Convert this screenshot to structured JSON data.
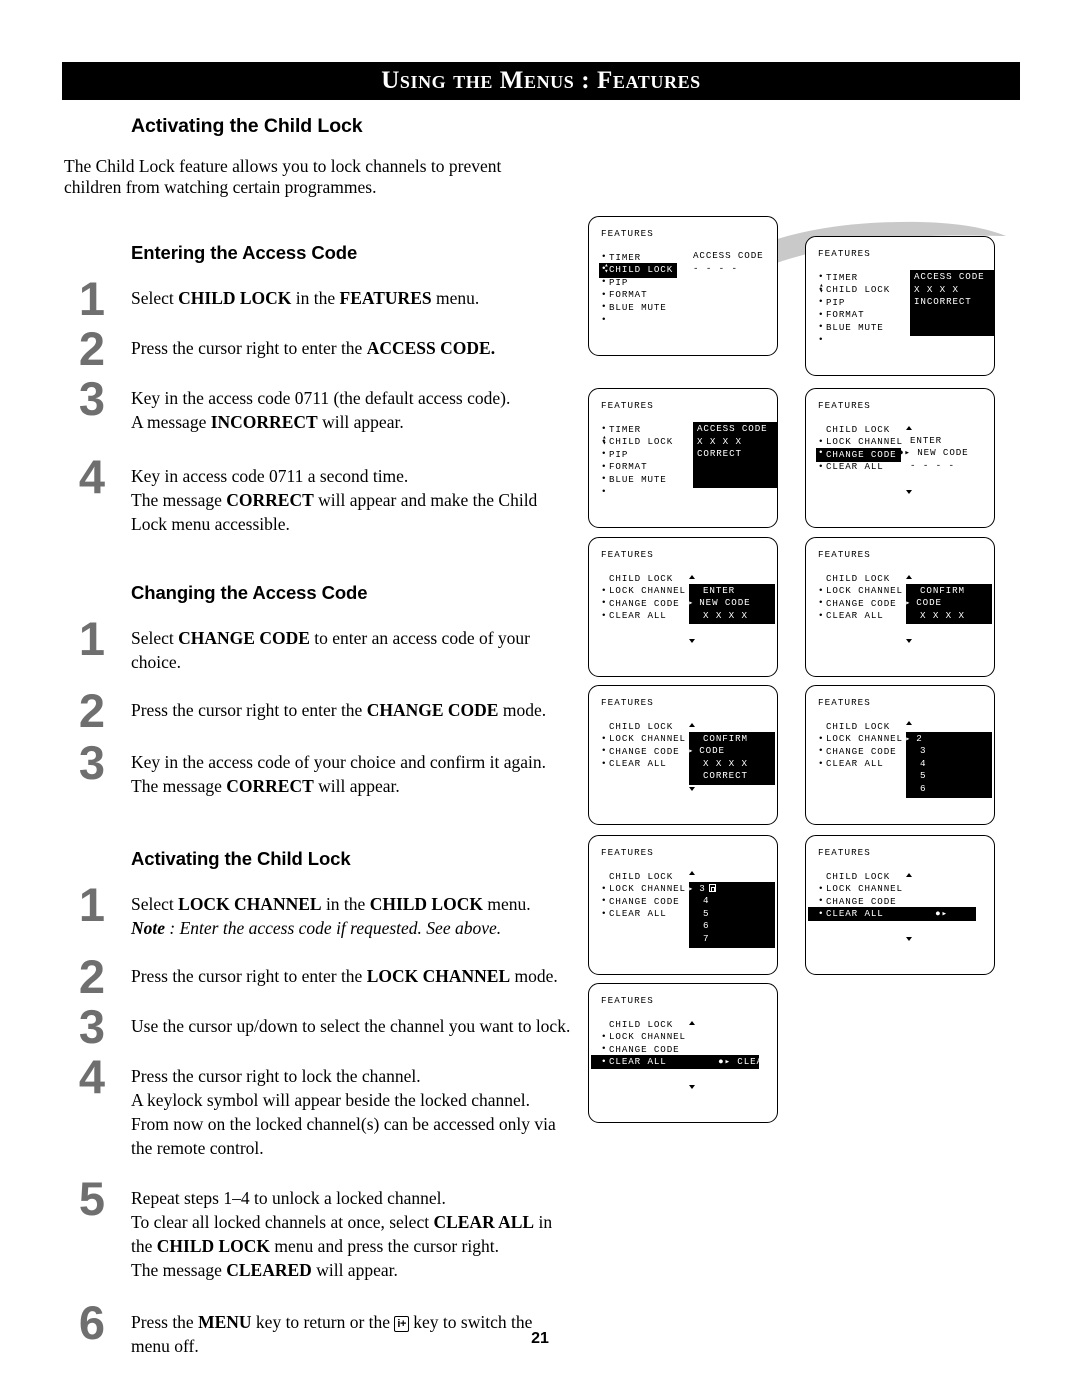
{
  "header": {
    "banner_title": "Using the Menus : Features"
  },
  "page_number": "21",
  "left": {
    "section_title": "Activating the Child Lock",
    "intro": "The Child Lock feature allows you to lock channels to prevent children from watching certain programmes.",
    "sub1_title": "Entering the Access Code",
    "sub2_title": "Changing the Access Code",
    "sub3_title": "Activating the Child Lock",
    "steps1": [
      {
        "num": "1",
        "lines": [
          "Select <b>CHILD LOCK</b> in the <b>FEATURES</b> menu."
        ]
      },
      {
        "num": "2",
        "lines": [
          "Press the cursor right to enter the <b>ACCESS CODE.</b>"
        ]
      },
      {
        "num": "3",
        "lines": [
          "Key in the access code 0711 (the default access code).",
          "A message <b>INCORRECT</b> will appear."
        ]
      },
      {
        "num": "4",
        "lines": [
          "Key in access code 0711 a second time.",
          "The message <b>CORRECT</b> will appear and make the Child Lock menu accessible."
        ]
      }
    ],
    "steps2": [
      {
        "num": "1",
        "lines": [
          "Select <b>CHANGE CODE</b> to enter an access code of your choice."
        ]
      },
      {
        "num": "2",
        "lines": [
          "Press the cursor right to enter the <b>CHANGE CODE</b> mode."
        ]
      },
      {
        "num": "3",
        "lines": [
          "Key in the access code of your choice and confirm it again.",
          "The message <b>CORRECT</b> will appear."
        ]
      }
    ],
    "steps3": [
      {
        "num": "1",
        "lines": [
          "Select <b>LOCK CHANNEL</b> in the <b>CHILD LOCK</b> menu.",
          "<i><b>Note</b> : Enter the access code if requested. See above.</i>"
        ]
      },
      {
        "num": "2",
        "lines": [
          "Press the cursor right to enter the <b>LOCK CHANNEL</b> mode."
        ]
      },
      {
        "num": "3",
        "lines": [
          "Use the cursor up/down to select the channel you want to lock."
        ]
      },
      {
        "num": "4",
        "lines": [
          "Press the cursor right to lock the channel.",
          "A keylock symbol will appear beside the locked channel.",
          "From now on the locked channel(s) can be accessed only via the remote control."
        ]
      },
      {
        "num": "5",
        "lines": [
          "Repeat steps 1–4 to unlock a locked channel.",
          "To clear all locked channels at once, select <b>CLEAR ALL</b> in the <b>CHILD LOCK</b> menu and press the cursor right.",
          "The message <b>CLEARED</b> will appear."
        ]
      },
      {
        "num": "6",
        "lines": [
          "Press the <b>MENU</b> key to return or the <span class=\"keyicon\">i+</span> key to switch the menu off.",
          ""
        ]
      }
    ]
  },
  "diagrams": [
    {
      "id": "d1",
      "head": "FEATURES",
      "rows": [
        "TIMER",
        "CHILD LOCK",
        "PIP",
        "FORMAT",
        "BLUE MUTE",
        ""
      ],
      "highlight_row": 1,
      "updown_row": 1,
      "values_plain": [
        "ACCESS CODE",
        "- - - -"
      ],
      "values_plain_row": 0
    },
    {
      "id": "d2",
      "head": "FEATURES",
      "rows": [
        "TIMER",
        "CHILD LOCK",
        "PIP",
        "FORMAT",
        "BLUE MUTE",
        ""
      ],
      "updown_row": 1,
      "panel": [
        "ACCESS CODE",
        "X X X X",
        "INCORRECT",
        "",
        ""
      ],
      "panel_row": 0
    },
    {
      "id": "d3",
      "head": "FEATURES",
      "rows": [
        "TIMER",
        "CHILD LOCK",
        "PIP",
        "FORMAT",
        "BLUE MUTE",
        ""
      ],
      "updown_row": 1,
      "panel": [
        "ACCESS CODE",
        "X X X X",
        "CORRECT",
        "",
        ""
      ],
      "panel_row": 0
    },
    {
      "id": "d4",
      "head": "FEATURES",
      "title_row": "CHILD LOCK",
      "rows": [
        "LOCK CHANNEL",
        "CHANGE CODE",
        "CLEAR ALL"
      ],
      "highlight_row": 1,
      "values_plain": [
        "ENTER",
        "NEW CODE",
        "- - - -"
      ],
      "cursor_marks": {
        "1": "●▸"
      },
      "scroll_arrows": true
    },
    {
      "id": "d5",
      "head": "FEATURES",
      "title_row": "CHILD LOCK",
      "rows": [
        "LOCK CHANNEL",
        "CHANGE CODE",
        "CLEAR ALL"
      ],
      "panel": [
        "ENTER",
        "NEW CODE",
        "X X X X"
      ],
      "panel_cursor_row": 1,
      "scroll_arrows": true
    },
    {
      "id": "d6",
      "head": "FEATURES",
      "title_row": "CHILD LOCK",
      "rows": [
        "LOCK CHANNEL",
        "CHANGE CODE",
        "CLEAR ALL"
      ],
      "panel": [
        "CONFIRM",
        "CODE",
        "X X X X"
      ],
      "panel_cursor_row": 1,
      "scroll_arrows": true
    },
    {
      "id": "d7",
      "head": "FEATURES",
      "title_row": "CHILD LOCK",
      "rows": [
        "LOCK CHANNEL",
        "CHANGE CODE",
        "CLEAR ALL"
      ],
      "panel": [
        "CONFIRM",
        "CODE",
        "X X X X",
        "CORRECT"
      ],
      "panel_cursor_row": 1,
      "scroll_arrows": true
    },
    {
      "id": "d8",
      "head": "FEATURES",
      "title_row": "CHILD LOCK",
      "rows": [
        "LOCK CHANNEL",
        "CHANGE CODE",
        "CLEAR ALL"
      ],
      "panel": [
        "2",
        "3",
        "4",
        "5",
        "6"
      ],
      "panel_cursor_row": 0,
      "scroll_arrows": true
    },
    {
      "id": "d9",
      "head": "FEATURES",
      "title_row": "CHILD LOCK",
      "rows": [
        "LOCK CHANNEL",
        "CHANGE CODE",
        "CLEAR ALL"
      ],
      "panel": [
        "3",
        "4",
        "5",
        "6",
        "7"
      ],
      "panel_cursor_row": 0,
      "panel_lock_row": 0,
      "scroll_arrows": true
    },
    {
      "id": "d10",
      "head": "FEATURES",
      "title_row": "CHILD LOCK",
      "rows": [
        "LOCK CHANNEL",
        "CHANGE CODE",
        "CLEAR ALL"
      ],
      "wide_highlight_row": 2,
      "wide_highlight_text": "CLEAR ALL",
      "wide_highlight_value": "●▸",
      "scroll_arrows": true
    },
    {
      "id": "d11",
      "head": "FEATURES",
      "title_row": "CHILD LOCK",
      "rows": [
        "LOCK CHANNEL",
        "CHANGE CODE",
        "CLEAR ALL"
      ],
      "wide_highlight_row": 2,
      "wide_highlight_text": "CLEAR ALL",
      "wide_highlight_value": "●▸ CLEARED",
      "scroll_arrows": true
    }
  ]
}
